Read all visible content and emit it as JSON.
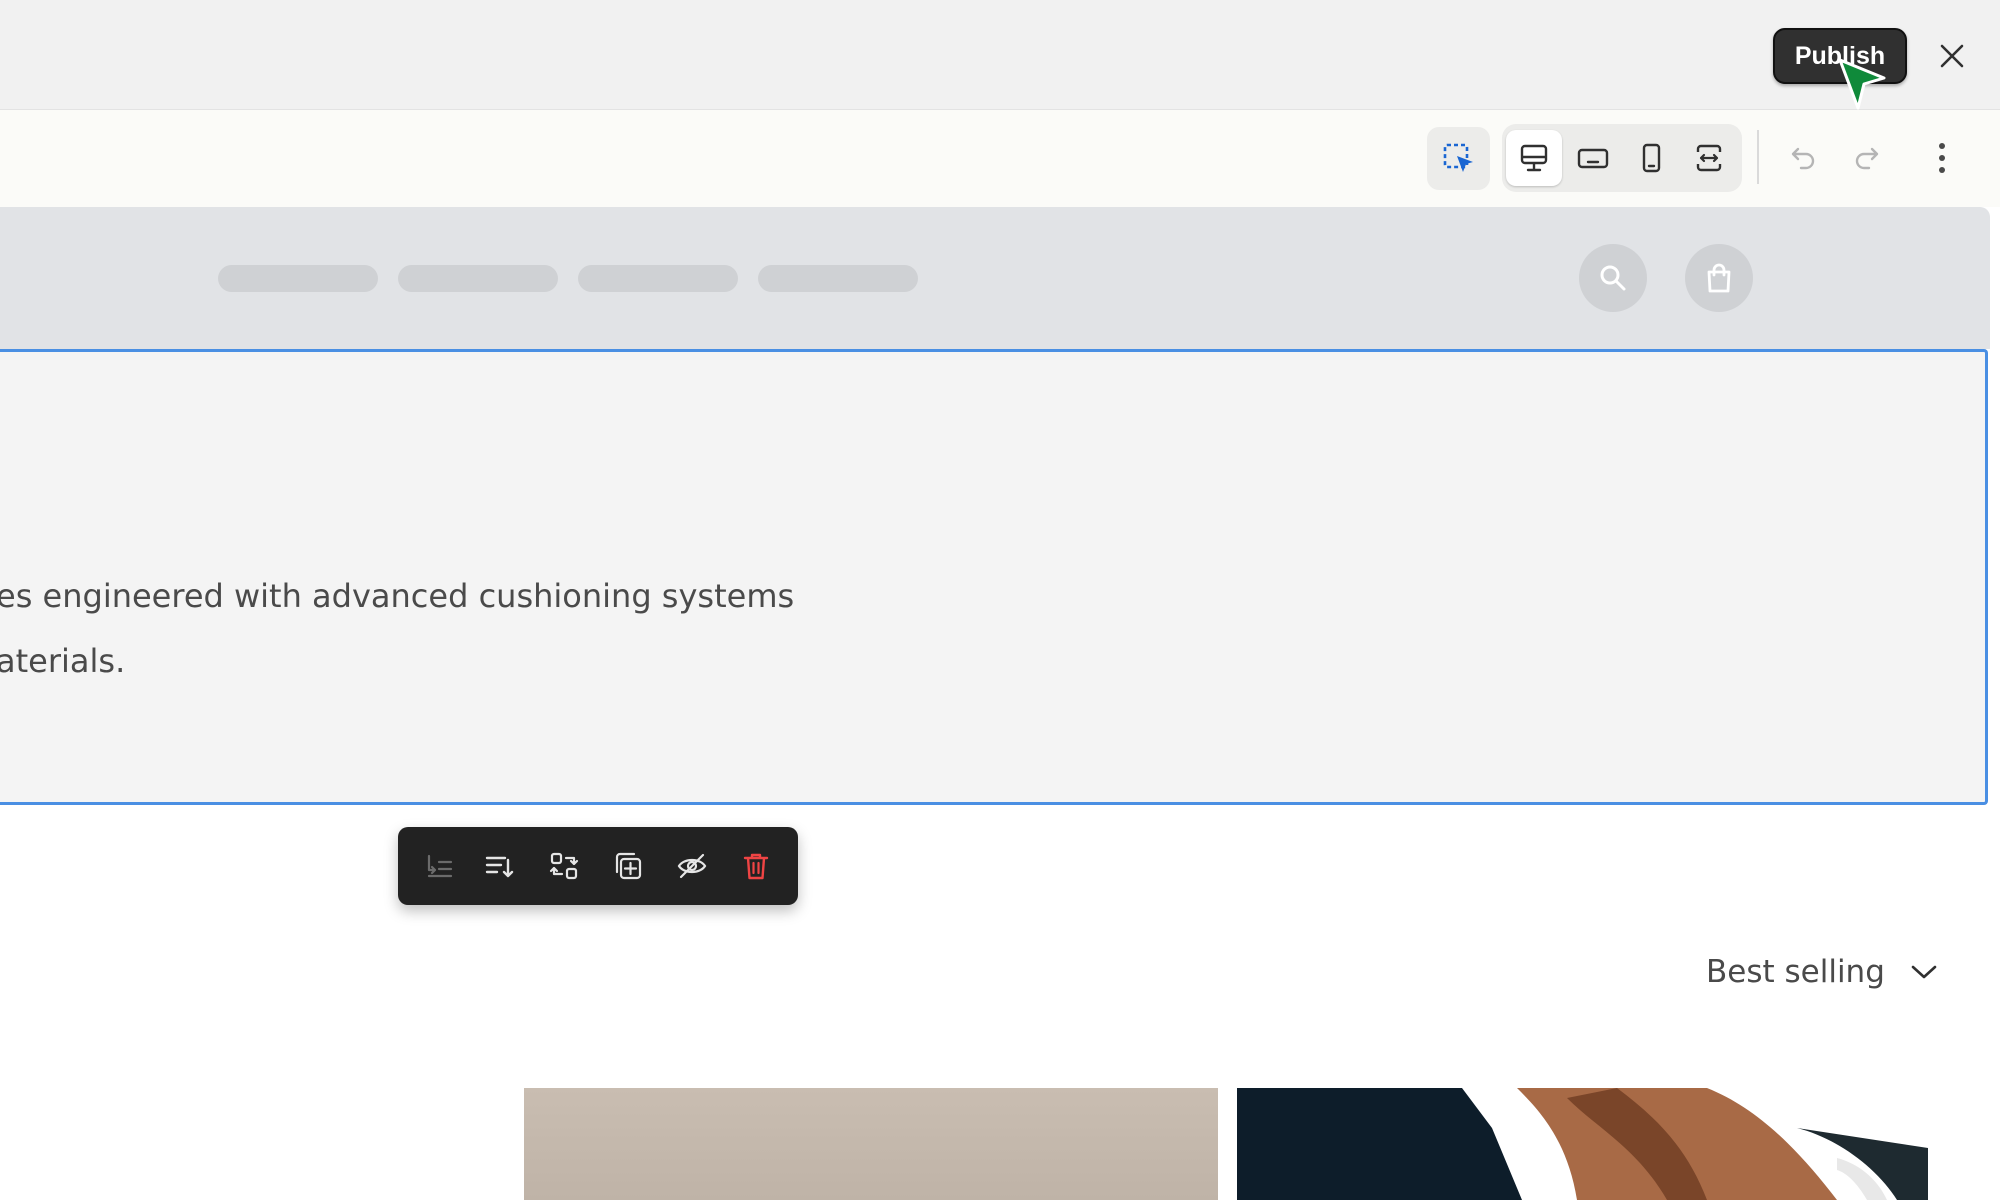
{
  "header": {
    "publish_label": "Publish",
    "close_icon": "close-icon",
    "cursor_icon": "mouse-pointer-icon",
    "cursor_color": "#0f8a3a"
  },
  "toolbar": {
    "select_icon": "select-element-icon",
    "accent": "#1a66d2",
    "view_modes": [
      {
        "icon": "desktop-icon",
        "active": true
      },
      {
        "icon": "tablet-landscape-icon",
        "active": false
      },
      {
        "icon": "mobile-icon",
        "active": false
      },
      {
        "icon": "full-width-icon",
        "active": false
      }
    ],
    "undo_icon": "undo-icon",
    "redo_icon": "redo-icon",
    "more_icon": "more-vertical-icon"
  },
  "preview": {
    "nav_placeholder_count": 4,
    "search_icon": "search-icon",
    "bag_icon": "shopping-bag-icon",
    "hero": {
      "line1": "es engineered with advanced cushioning systems",
      "line2": "aterials.",
      "selection_color": "#4a8fe3"
    },
    "floating_toolbar": {
      "buttons": [
        "outdent-icon",
        "move-down-icon",
        "swap-icon",
        "duplicate-icon",
        "hide-icon",
        "delete-icon"
      ],
      "delete_color": "#ef4444"
    },
    "sort": {
      "selected": "Best selling",
      "icon": "chevron-down-icon"
    }
  }
}
